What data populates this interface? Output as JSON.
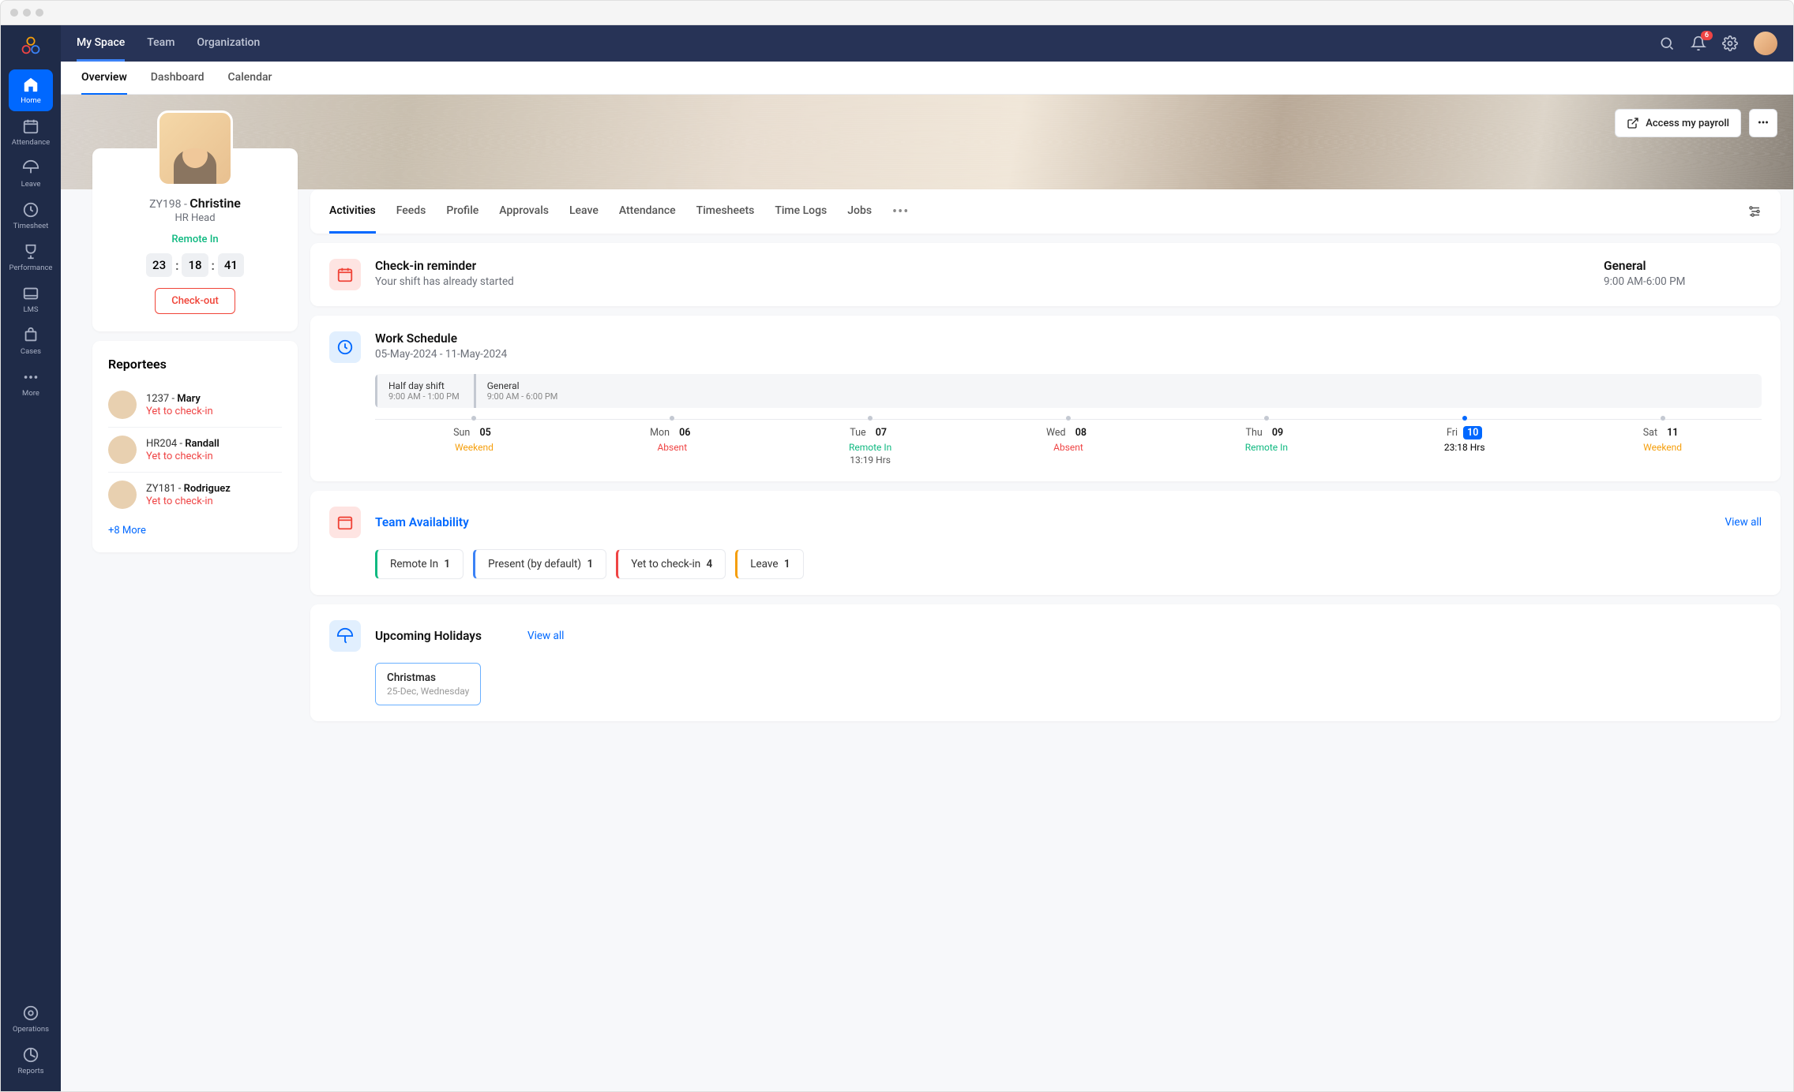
{
  "topnav": {
    "tabs": [
      "My Space",
      "Team",
      "Organization"
    ],
    "notif_count": "6"
  },
  "subnav": {
    "tabs": [
      "Overview",
      "Dashboard",
      "Calendar"
    ]
  },
  "sidebar": {
    "items": [
      {
        "label": "Home"
      },
      {
        "label": "Attendance"
      },
      {
        "label": "Leave"
      },
      {
        "label": "Timesheet"
      },
      {
        "label": "Performance"
      },
      {
        "label": "LMS"
      },
      {
        "label": "Cases"
      },
      {
        "label": "More"
      }
    ],
    "bottom": [
      {
        "label": "Operations"
      },
      {
        "label": "Reports"
      }
    ]
  },
  "banner": {
    "payroll": "Access my payroll"
  },
  "profile": {
    "code": "ZY198 - ",
    "name": "Christine",
    "role": "HR Head",
    "status": "Remote In",
    "timer": {
      "h": "23",
      "m": "18",
      "s": "41"
    },
    "checkout": "Check-out"
  },
  "reportees": {
    "title": "Reportees",
    "items": [
      {
        "code": "1237 - ",
        "name": "Mary",
        "status": "Yet to check-in"
      },
      {
        "code": "HR204 - ",
        "name": "Randall",
        "status": "Yet to check-in"
      },
      {
        "code": "ZY181 - ",
        "name": "Rodriguez",
        "status": "Yet to check-in"
      }
    ],
    "more": "+8 More"
  },
  "activity_tabs": [
    "Activities",
    "Feeds",
    "Profile",
    "Approvals",
    "Leave",
    "Attendance",
    "Timesheets",
    "Time Logs",
    "Jobs"
  ],
  "checkin": {
    "title": "Check-in reminder",
    "sub": "Your shift has already started",
    "rtitle": "General",
    "rtime": "9:00 AM-6:00 PM"
  },
  "schedule": {
    "title": "Work Schedule",
    "range": "05-May-2024    -    11-May-2024",
    "shifts": [
      {
        "name": "Half day shift",
        "time": "9:00 AM - 1:00 PM"
      },
      {
        "name": "General",
        "time": "9:00 AM - 6:00 PM"
      }
    ],
    "days": [
      {
        "day": "Sun",
        "num": "05",
        "status": "Weekend",
        "cls": "st-weekend"
      },
      {
        "day": "Mon",
        "num": "06",
        "status": "Absent",
        "cls": "st-absent"
      },
      {
        "day": "Tue",
        "num": "07",
        "status": "Remote In",
        "cls": "st-remote",
        "hrs": "13:19 Hrs"
      },
      {
        "day": "Wed",
        "num": "08",
        "status": "Absent",
        "cls": "st-absent"
      },
      {
        "day": "Thu",
        "num": "09",
        "status": "Remote In",
        "cls": "st-remote"
      },
      {
        "day": "Fri",
        "num": "10",
        "status": "23:18 Hrs",
        "cls": "",
        "active": true
      },
      {
        "day": "Sat",
        "num": "11",
        "status": "Weekend",
        "cls": "st-weekend"
      }
    ]
  },
  "availability": {
    "title": "Team Availability",
    "viewall": "View all",
    "items": [
      {
        "label": "Remote In",
        "count": "1",
        "cls": "bl-green"
      },
      {
        "label": "Present (by default)",
        "count": "1",
        "cls": "bl-blue"
      },
      {
        "label": "Yet to check-in",
        "count": "4",
        "cls": "bl-red"
      },
      {
        "label": "Leave",
        "count": "1",
        "cls": "bl-orange"
      }
    ]
  },
  "holidays": {
    "title": "Upcoming Holidays",
    "viewall": "View all",
    "item": {
      "name": "Christmas",
      "date": "25-Dec, Wednesday"
    }
  }
}
